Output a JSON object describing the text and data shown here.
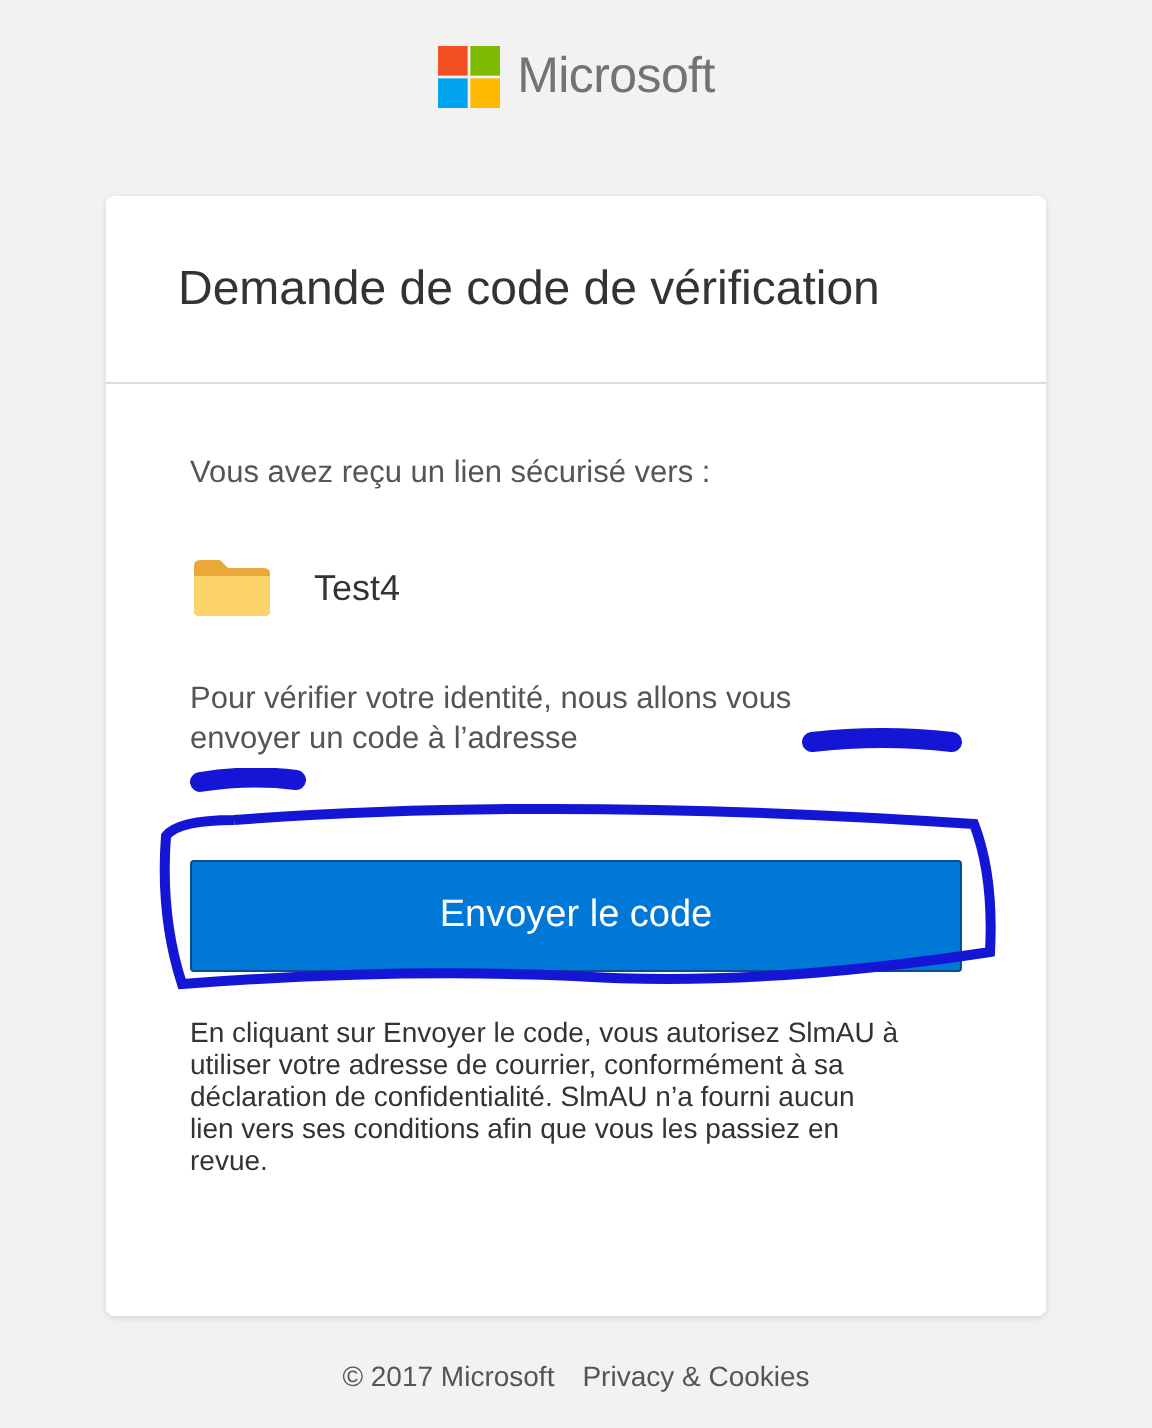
{
  "brand": {
    "name": "Microsoft"
  },
  "card": {
    "title": "Demande de code de vérification",
    "intro": "Vous avez reçu un lien sécurisé vers :",
    "item": {
      "kind": "folder",
      "name": "Test4"
    },
    "message": "Pour vérifier votre identité, nous allons vous envoyer un code à l’adresse",
    "button": "Envoyer le code",
    "notice": "En cliquant sur Envoyer le code, vous autorisez SlmAU à utiliser votre adresse de courrier, conformément à sa déclaration de confidentialité. SlmAU n’a fourni aucun lien vers ses conditions afin que vous les passiez en revue."
  },
  "footer": {
    "copyright": "© 2017 Microsoft",
    "link": "Privacy & Cookies"
  }
}
